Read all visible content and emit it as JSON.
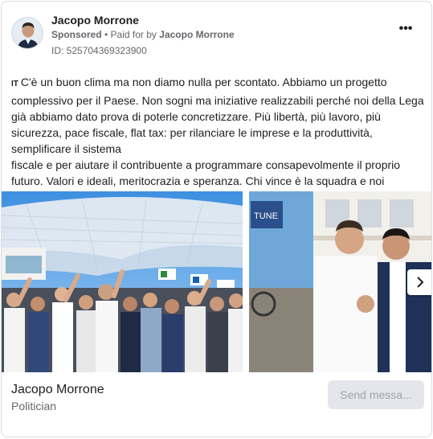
{
  "post": {
    "page_name": "Jacopo Morrone",
    "sponsored_label": "Sponsored",
    "separator": " • ",
    "paid_for_by_prefix": "Paid for by",
    "paid_for_by_name": "Jacopo Morrone",
    "ad_id": "ID: 525704369323900",
    "more_icon_label": "•••",
    "flag": "IT",
    "body_text": "C'è un buon clima ma non diamo nulla per scontato. Abbiamo un progetto complessivo per il Paese. Non sogni ma iniziative realizzabili perché noi della Lega già abbiamo dato prova di poterle concretizzare. Più libertà, più lavoro, più sicurezza, pace fiscale, flat tax: per rilanciare le imprese e la produttività, semplificare il sistema",
    "body_text_2": "fiscale e per aiutare il contribuente a programmare consapevolmente il proprio futuro. Valori e ideali, meritocrazia e speranza. Chi vince è la squadra e noi siamo…"
  },
  "carousel": {
    "slides": [
      {
        "subject": "crowd-photo"
      },
      {
        "subject": "handshake-photo",
        "sign_text": "TUNE"
      }
    ]
  },
  "footer": {
    "name": "Jacopo Morrone",
    "category": "Politician",
    "cta_label": "Send messa..."
  },
  "colors": {
    "text_primary": "#1c1e21",
    "text_secondary": "#65676b",
    "border": "#dadde1",
    "button_bg": "#e4e6eb",
    "button_text_disabled": "#a0a4aa"
  }
}
